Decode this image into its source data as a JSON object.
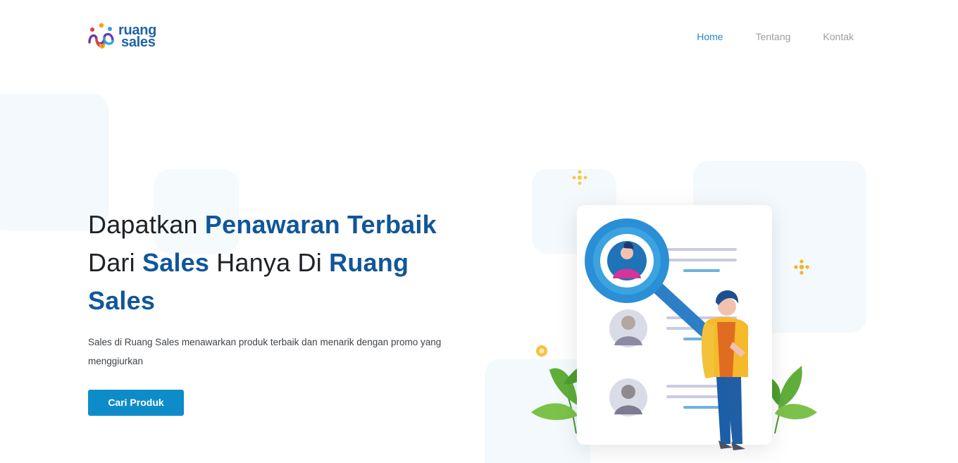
{
  "brand": {
    "line1": "ruang",
    "line2": "sales"
  },
  "nav": {
    "home": "Home",
    "about": "Tentang",
    "contact": "Kontak"
  },
  "hero": {
    "t1": "Dapatkan ",
    "t2": "Penawaran Terbaik",
    "t3": "Dari ",
    "t4": "Sales",
    "t5": " Hanya Di ",
    "t6": "Ruang",
    "t7": "Sales",
    "description": "Sales di Ruang Sales menawarkan produk terbaik dan menarik dengan promo yang menggiurkan",
    "cta": "Cari Produk"
  },
  "colors": {
    "accent": "#0e8cc9",
    "heading_highlight": "#11569a",
    "nav_active": "#2a86c7"
  }
}
